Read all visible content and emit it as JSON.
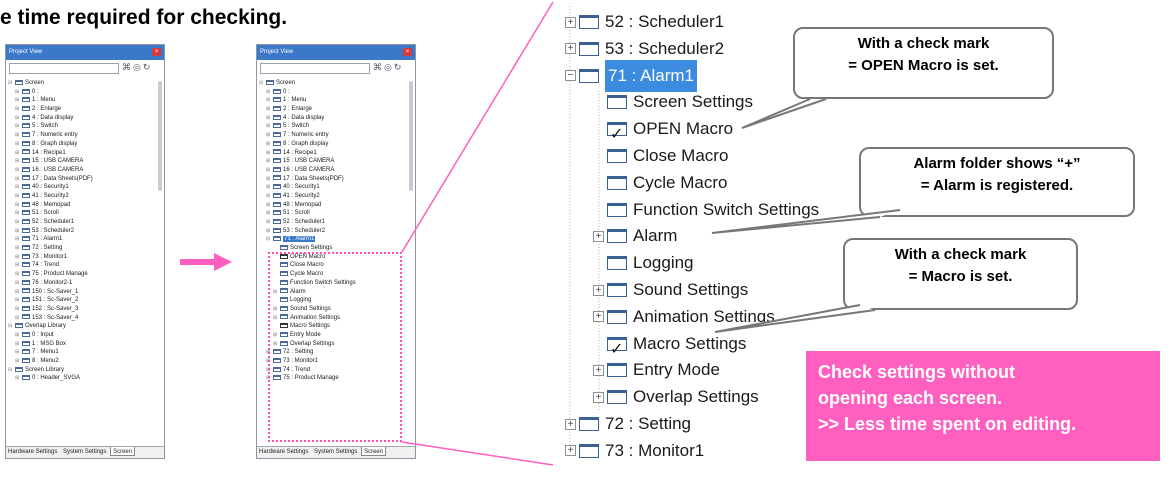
{
  "page_title": "e time required for checking.",
  "project_view": {
    "title": "Project View",
    "close_glyph": "×",
    "tabs": [
      "Hardware Settings",
      "System Settings",
      "Screen"
    ],
    "left_tree": [
      "Screen",
      "0 :",
      "1 : Menu",
      "2 : Enlarge",
      "4 : Data display",
      "5 : Switch",
      "7 : Numeric entry",
      "8 : Graph display",
      "14 : Recipe1",
      "15 : USB CAMERA",
      "16 : USB CAMERA",
      "17 : Data Sheets(PDF)",
      "40 : Security1",
      "41 : Security2",
      "48 : Memopad",
      "51 : Scroll",
      "52 : Scheduler1",
      "53 : Scheduler2",
      "71 : Alarm1",
      "72 : Setting",
      "73 : Monitor1",
      "74 : Trend",
      "75 : Product Manage",
      "76 : Monitor2-1",
      "150 : Sc-Saver_1",
      "151 : Sc-Saver_2",
      "152 : Sc-Saver_3",
      "153 : Sc-Saver_4",
      "Overlap Library",
      "0 : Input",
      "1 : MSG Box",
      "7 : Menu1",
      "8 : Menu2",
      "Screen Library",
      "0 : Header_SVGA"
    ],
    "right_tree": [
      "Screen",
      "0 :",
      "1 : Menu",
      "2 : Enlarge",
      "4 : Data display",
      "5 : Switch",
      "7 : Numeric entry",
      "8 : Graph display",
      "14 : Recipe1",
      "15 : USB CAMERA",
      "16 : USB CAMERA",
      "17 : Data Sheets(PDF)",
      "40 : Security1",
      "41 : Security2",
      "48 : Memopad",
      "51 : Scroll",
      "52 : Scheduler1",
      "53 : Scheduler2",
      "71 : Alarm1",
      "Screen Settings",
      "OPEN Macro",
      "Close Macro",
      "Cycle Macro",
      "Function Switch Settings",
      "Alarm",
      "Logging",
      "Sound Settings",
      "Animation Settings",
      "Macro Settings",
      "Entry Mode",
      "Overlap Settings",
      "72 : Setting",
      "73 : Monitor1",
      "74 : Trend",
      "75 : Product Manage"
    ]
  },
  "zoom_tree": {
    "items": [
      "52 : Scheduler1",
      "53 : Scheduler2",
      "71 : Alarm1",
      "Screen Settings",
      "OPEN Macro",
      "Close Macro",
      "Cycle Macro",
      "Function Switch Settings",
      "Alarm",
      "Logging",
      "Sound Settings",
      "Animation Settings",
      "Macro Settings",
      "Entry Mode",
      "Overlap Settings",
      "72 : Setting",
      "73 : Monitor1"
    ]
  },
  "callouts": {
    "open_macro": [
      "With a check mark",
      "= OPEN Macro is set."
    ],
    "alarm": [
      "Alarm folder shows “+”",
      "= Alarm is registered."
    ],
    "macro": [
      "With a check mark",
      "= Macro is set."
    ]
  },
  "note": [
    "Check settings without",
    "opening each screen.",
    ">> Less time spent on editing."
  ],
  "colors": {
    "accent_pink": "#ff5fbe",
    "selection_blue": "#3b8cdf",
    "titlebar_blue": "#3c78c8"
  }
}
